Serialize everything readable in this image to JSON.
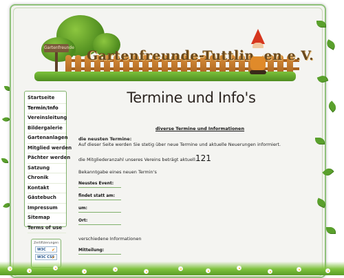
{
  "header": {
    "title": "Gartenfreunde-Tuttlingen e.V.",
    "sign_text": "Gartenfreunde"
  },
  "sidebar": {
    "items": [
      {
        "label": "Startseite"
      },
      {
        "label": "Termin/Info"
      },
      {
        "label": "Vereinsleitung"
      },
      {
        "label": "Bildergalerie"
      },
      {
        "label": "Gartenanlagen"
      },
      {
        "label": "Mitglied werden"
      },
      {
        "label": "Pächter werden"
      },
      {
        "label": "Satzung"
      },
      {
        "label": "Chronik"
      },
      {
        "label": "Kontakt"
      },
      {
        "label": "Gästebuch"
      },
      {
        "label": "Impressum"
      },
      {
        "label": "Sitemap"
      },
      {
        "label": "Terms of use"
      }
    ],
    "badges_caption": "Zertifizierungen",
    "badge_xhtml": "W3C XHTML",
    "badge_css": "W3C CSS"
  },
  "main": {
    "page_title": "Termine und Info's",
    "section_link": "diverse Termine und Informationen",
    "newest_heading": "die neusten Termine:",
    "newest_text": "Auf dieser Seite werden Sie stetig über neue Termine und aktuelle Neuerungen informiert.",
    "members_text": "die Mitgliederanzahl unseres Vereins beträgt aktuell:",
    "members_count": "121",
    "announce_text": "Bekanntgabe eines neuen Termin's",
    "field_event": "Neustes Event:",
    "field_date": "findet statt am:",
    "field_time": "um:",
    "field_place": "Ort:",
    "misc_text": "verschiedene Informationen",
    "field_message": "Mitteilung:"
  },
  "colors": {
    "frame_border": "#8fc17a",
    "page_bg": "#f4f4f1",
    "nav_border": "#7fb06a",
    "grass": "#7fc23e"
  }
}
